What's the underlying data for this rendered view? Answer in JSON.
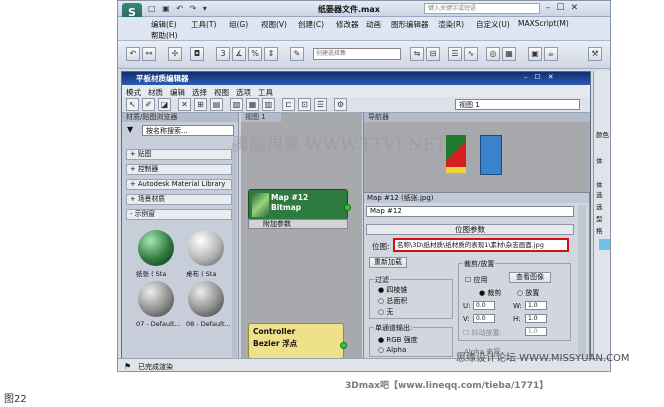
{
  "app": {
    "logo": "S",
    "title": "纸篓器文件.max",
    "search": "键入关键字或短语"
  },
  "menu": [
    "编辑(E)",
    "工具(T)",
    "组(G)",
    "视图(V)",
    "创建(C)",
    "修改器",
    "动画",
    "图形编辑器",
    "渲染(R)",
    "自定义(U)",
    "MAXScript(M)",
    "帮助(H)"
  ],
  "toolbar": {
    "selection_set": "创建选择集"
  },
  "mat_editor": {
    "title": "平板材质编辑器",
    "menu": [
      "模式",
      "材质",
      "编辑",
      "选择",
      "视图",
      "选项",
      "工具"
    ],
    "view_select": "视图 1",
    "browser": {
      "header": "材质/贴图浏览器",
      "search": "按名称搜索...",
      "categories": [
        "+ 贴图",
        "+ 控制器",
        "+ Autodesk Material Library",
        "+ 场景材质",
        "- 示例窗"
      ],
      "slots": [
        "纸张 ( Sta",
        "桌布 ( Sta",
        "07 - Default...",
        "08 - Default..."
      ]
    },
    "view1_tab": "视图 1",
    "navigator": "导航器",
    "node1": {
      "line1": "Map #12",
      "line2": "Bitmap",
      "sub": "附加参数"
    },
    "node2": {
      "line1": "Controller",
      "line2": "Bezier 浮点"
    },
    "props": {
      "title": "Map #12 (纸张.jpg)",
      "name": "Map #12",
      "rollout": "位图参数",
      "bitmap_label": "位图:",
      "bitmap_path": "名称\\3D\\纸材质\\纸材质的表现1\\素材\\杂志画面.jpg",
      "reload": "重新加载",
      "crop_group": "裁剪/放置",
      "apply": "应用",
      "view_image": "查看图像",
      "crop": "裁剪",
      "place": "放置",
      "filter_group": "过滤",
      "filters": [
        "四棱锥",
        "总面积",
        "无"
      ],
      "u_lbl": "U:",
      "v_lbl": "V:",
      "w_lbl": "W:",
      "h_lbl": "H:",
      "u": "0.0",
      "v": "0.0",
      "w": "1.0",
      "h": "1.0",
      "jitter": "抖动放置:",
      "jitter_val": "1.0",
      "mono_group": "单通道输出:",
      "mono_opts": [
        "RGB 强度",
        "Alpha"
      ],
      "alpha_source": "Alpha 来源"
    }
  },
  "side": [
    "颜色",
    "体",
    "体",
    "选",
    "选",
    "型",
    "格"
  ],
  "status": "已完成渲染",
  "figure_label": "图22",
  "watermarks": {
    "center": "腾龍視覺 WWW.TTVI.NET",
    "forum": "思缘设计论坛 WWW.MISSYUAN.COM",
    "bottom": "3Dmax吧【www.lineqq.com/tieba/1771】"
  }
}
